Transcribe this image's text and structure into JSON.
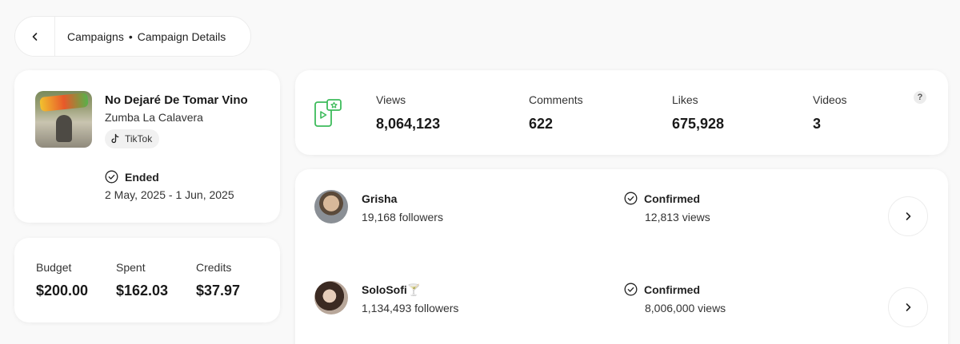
{
  "breadcrumb": {
    "items": [
      "Campaigns",
      "Campaign Details"
    ],
    "separator": "•"
  },
  "song": {
    "title": "No Dejaré De Tomar Vino",
    "artist": "Zumba La Calavera",
    "platform": "TikTok",
    "status": "Ended",
    "dates": "2 May, 2025 - 1 Jun, 2025"
  },
  "budget": {
    "items": [
      {
        "label": "Budget",
        "value": "$200.00"
      },
      {
        "label": "Spent",
        "value": "$162.03"
      },
      {
        "label": "Credits",
        "value": "$37.97"
      }
    ]
  },
  "stats": {
    "items": [
      {
        "label": "Views",
        "value": "8,064,123"
      },
      {
        "label": "Comments",
        "value": "622"
      },
      {
        "label": "Likes",
        "value": "675,928"
      },
      {
        "label": "Videos",
        "value": "3"
      }
    ],
    "help": "?"
  },
  "creators": [
    {
      "name": "Grisha",
      "followers": "19,168 followers",
      "status": "Confirmed",
      "views": "12,813 views"
    },
    {
      "name": "SoloSofi🍸",
      "followers": "1,134,493 followers",
      "status": "Confirmed",
      "views": "8,006,000 views"
    }
  ],
  "colors": {
    "accent_green": "#3dbb5b",
    "background": "#f9f9f9",
    "card": "#ffffff"
  },
  "icons": {
    "back": "chevron-left-icon",
    "platform": "tiktok-icon",
    "status": "check-circle-icon",
    "stats": "video-phone-icon",
    "row_action": "chevron-right-icon"
  }
}
